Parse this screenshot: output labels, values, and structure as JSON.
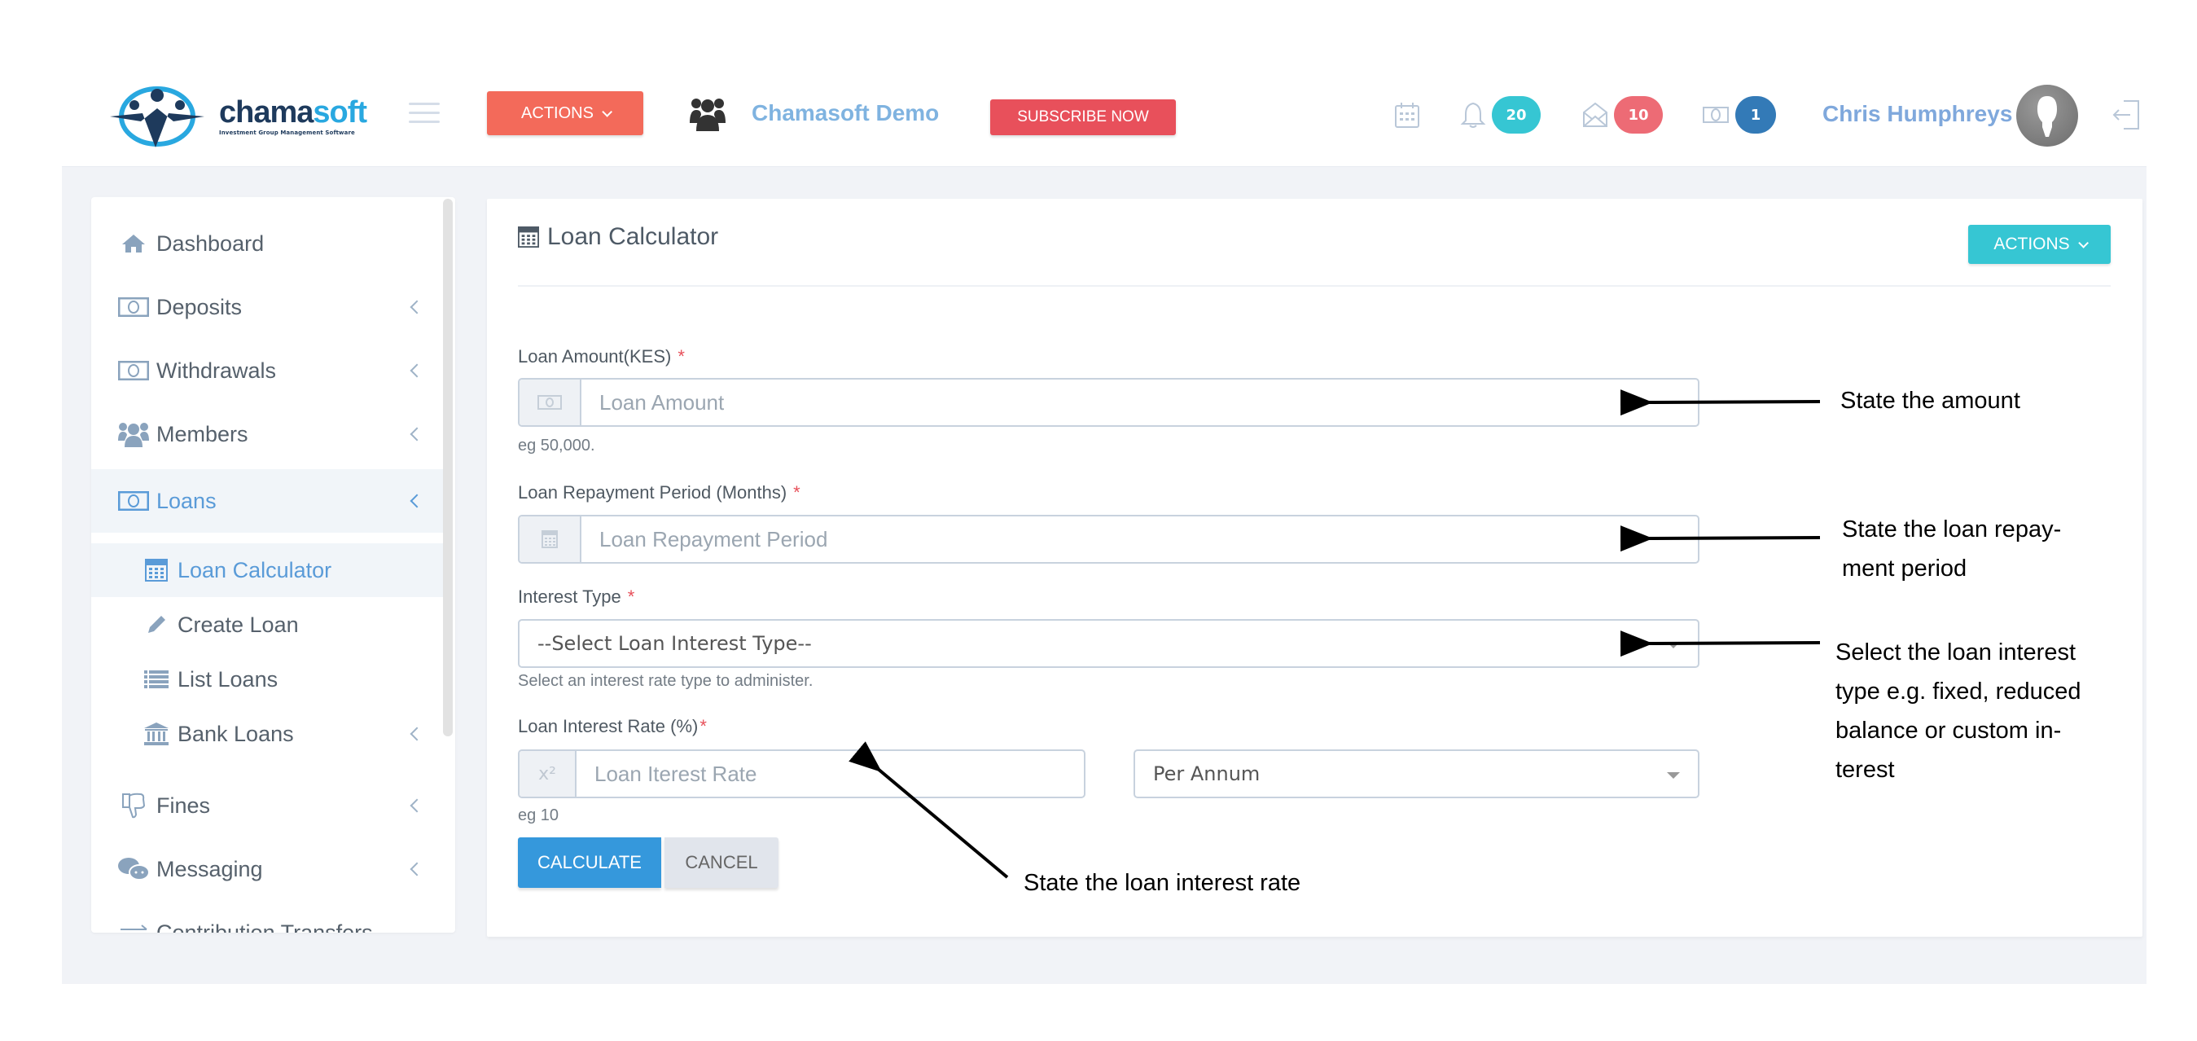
{
  "header": {
    "logo": {
      "word_part1": "chama",
      "word_part2": "soft",
      "tagline": "Investment Group Management Software"
    },
    "actions_label": "ACTIONS",
    "group_name": "Chamasoft Demo",
    "subscribe_label": "SUBSCRIBE NOW",
    "notifications": [
      {
        "icon": "calendar-icon"
      },
      {
        "icon": "bell-icon",
        "count": "20",
        "color": "#36c6d3"
      },
      {
        "icon": "envelope-icon",
        "count": "10",
        "color": "#ed6b75"
      },
      {
        "icon": "money-icon",
        "count": "1",
        "color": "#337ab7"
      }
    ],
    "user_name": "Chris Humphreys"
  },
  "sidebar": {
    "items": [
      {
        "label": "Dashboard",
        "icon": "home-icon",
        "has_children": false
      },
      {
        "label": "Deposits",
        "icon": "money-icon",
        "has_children": true
      },
      {
        "label": "Withdrawals",
        "icon": "money-icon",
        "has_children": true
      },
      {
        "label": "Members",
        "icon": "users-icon",
        "has_children": true
      },
      {
        "label": "Loans",
        "icon": "money-icon",
        "has_children": true,
        "active": true
      },
      {
        "label": "Fines",
        "icon": "thumbs-down-icon",
        "has_children": true
      },
      {
        "label": "Messaging",
        "icon": "chat-icon",
        "has_children": true
      },
      {
        "label": "Contribution Transfers",
        "icon": "exchange-icon",
        "has_children": false
      }
    ],
    "loans_submenu": [
      {
        "label": "Loan Calculator",
        "icon": "calculator-icon",
        "active": true
      },
      {
        "label": "Create Loan",
        "icon": "pencil-icon"
      },
      {
        "label": "List Loans",
        "icon": "list-icon"
      },
      {
        "label": "Bank Loans",
        "icon": "bank-icon",
        "has_children": true
      }
    ]
  },
  "main": {
    "title": "Loan Calculator",
    "actions_label": "ACTIONS",
    "form": {
      "loan_amount": {
        "label": "Loan Amount(KES)",
        "required": "*",
        "placeholder": "Loan Amount",
        "value": "",
        "help": "eg 50,000."
      },
      "repayment_period": {
        "label": "Loan Repayment Period (Months)",
        "required": "*",
        "placeholder": "Loan Repayment Period",
        "value": ""
      },
      "interest_type": {
        "label": "Interest Type",
        "required": "*",
        "selected": "--Select Loan Interest Type--",
        "help": "Select an interest rate type to administer."
      },
      "interest_rate": {
        "label": "Loan Interest Rate (%)",
        "required": "*",
        "placeholder": "Loan Iterest Rate",
        "value": "",
        "addon": "x²",
        "help": "eg 10"
      },
      "rate_period": {
        "selected": "Per Annum"
      },
      "calculate_label": "CALCULATE",
      "cancel_label": "CANCEL"
    }
  },
  "annotations": {
    "amount": "State the amount",
    "repayment_line1": "State  the loan repay-",
    "repayment_line2": "ment period",
    "interest_type_lines": [
      "Select the loan interest",
      "type e.g. fixed, reduced",
      "balance or custom in-",
      "terest"
    ],
    "interest_rate": "State the loan interest rate"
  }
}
